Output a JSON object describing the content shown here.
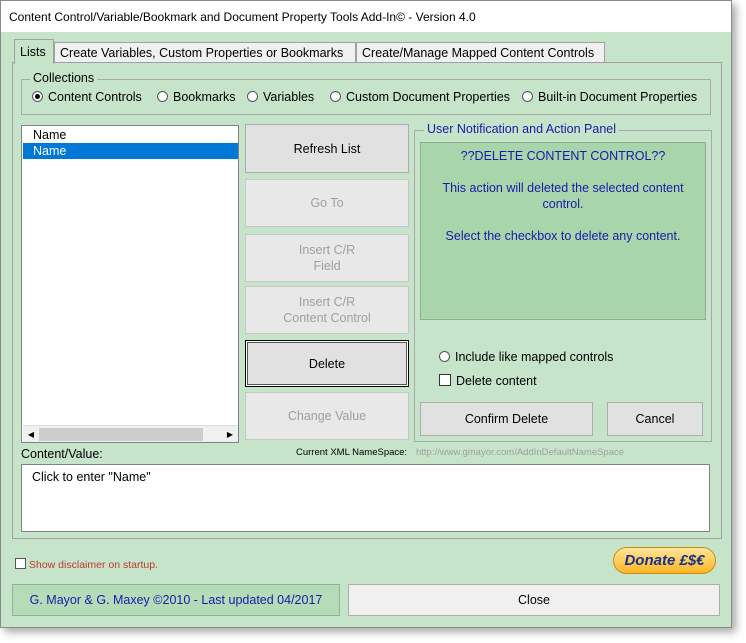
{
  "window": {
    "title": "Content Control/Variable/Bookmark and Document Property Tools Add-In© - Version 4.0"
  },
  "tabs": [
    {
      "label": "Lists",
      "active": true
    },
    {
      "label": "Create Variables, Custom Properties or Bookmarks",
      "active": false
    },
    {
      "label": "Create/Manage Mapped Content Controls",
      "active": false
    }
  ],
  "collections": {
    "legend": "Collections",
    "options": [
      {
        "label": "Content Controls",
        "selected": true
      },
      {
        "label": "Bookmarks",
        "selected": false
      },
      {
        "label": "Variables",
        "selected": false
      },
      {
        "label": "Custom Document Properties",
        "selected": false
      },
      {
        "label": "Built-in Document Properties",
        "selected": false
      }
    ]
  },
  "list": {
    "items": [
      {
        "label": "Name",
        "selected": false
      },
      {
        "label": "Name",
        "selected": true
      }
    ]
  },
  "buttons": {
    "refresh": "Refresh List",
    "goto": "Go To",
    "insert_field": [
      "Insert C/R",
      "Field"
    ],
    "insert_cc": [
      "Insert C/R",
      "Content Control"
    ],
    "delete": "Delete",
    "change_value": "Change Value",
    "confirm_delete": "Confirm Delete",
    "cancel": "Cancel",
    "footer_credit": "G. Mayor & G. Maxey ©2010 - Last updated 04/2017",
    "close": "Close",
    "donate": "Donate £$€"
  },
  "panel": {
    "legend": "User Notification and Action Panel",
    "heading": "??DELETE CONTENT CONTROL??",
    "message1": [
      "This action will deleted the selected content",
      "control."
    ],
    "message2": "Select the checkbox to delete any content.",
    "option_mapped": "Include like mapped controls",
    "option_delete_content": "Delete content"
  },
  "xml": {
    "label": "Current XML NameSpace:",
    "value": "http://www.gmayor.com/AddInDefaultNameSpace"
  },
  "content": {
    "label": "Content/Value:",
    "value": "Click to enter \"Name\""
  },
  "disclaimer": {
    "label": "Show disclaimer on startup."
  },
  "colors": {
    "background": "#c6e4c9",
    "panel": "#a9d5ab",
    "panel_text": "#1a1aa8",
    "selection": "#0078d7",
    "disclaimer_text": "#c0392b"
  }
}
